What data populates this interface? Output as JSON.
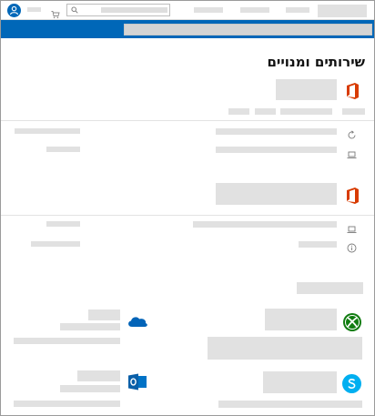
{
  "page": {
    "title": "שירותים ומנויים"
  },
  "colors": {
    "brand_blue": "#0067b8",
    "office_orange": "#d83b01",
    "xbox_green": "#107c10",
    "onedrive_blue": "#0364b8",
    "outlook_blue": "#0072c6",
    "skype_blue": "#00aff0"
  },
  "icons": {
    "account": "person-circle-icon",
    "cart": "shopping-cart-icon",
    "search": "magnifier-icon",
    "office": "office-logo",
    "refresh": "refresh-icon",
    "device": "laptop-icon",
    "info": "info-circle-icon",
    "xbox": "xbox-logo",
    "onedrive": "onedrive-logo",
    "outlook": "outlook-logo",
    "skype": "skype-logo"
  }
}
